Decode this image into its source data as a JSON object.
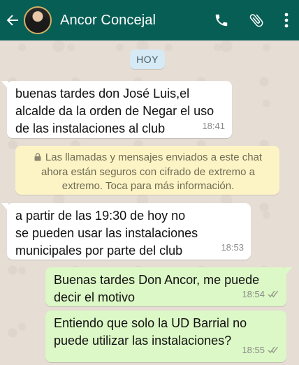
{
  "header": {
    "contact_name": "Ancor Concejal",
    "icons": [
      "back-arrow-icon",
      "phone-icon",
      "paperclip-icon",
      "more-vert-icon"
    ],
    "color": "#075e54"
  },
  "date_chip": "HOY",
  "messages": [
    {
      "direction": "in",
      "text": "buenas tardes don José Luis,el\nalcalde da la orden de Negar el uso\nde las instalaciones al club",
      "time": "18:41"
    },
    {
      "direction": "in",
      "text": "a partir de las 19:30 de hoy no\nse pueden usar las instalaciones\nmunicipales por parte del club",
      "time": "18:53"
    },
    {
      "direction": "out",
      "text": "Buenas tardes Don Ancor, me puede\ndecir el motivo",
      "time": "18:54",
      "status": "double-check-icon"
    },
    {
      "direction": "out",
      "text": "Entiendo que solo la UD Barrial no\npuede utilizar las instalaciones?",
      "time": "18:55",
      "status": "double-check-icon"
    }
  ],
  "encryption_notice": "Las llamadas y mensajes enviados a este chat ahora están seguros con cifrado de extremo a extremo. Toca para más información.",
  "colors": {
    "incoming_bubble": "#ffffff",
    "outgoing_bubble": "#dcf8c6",
    "chat_background": "#e6ddd4",
    "notice_background": "#fdf4c5"
  }
}
